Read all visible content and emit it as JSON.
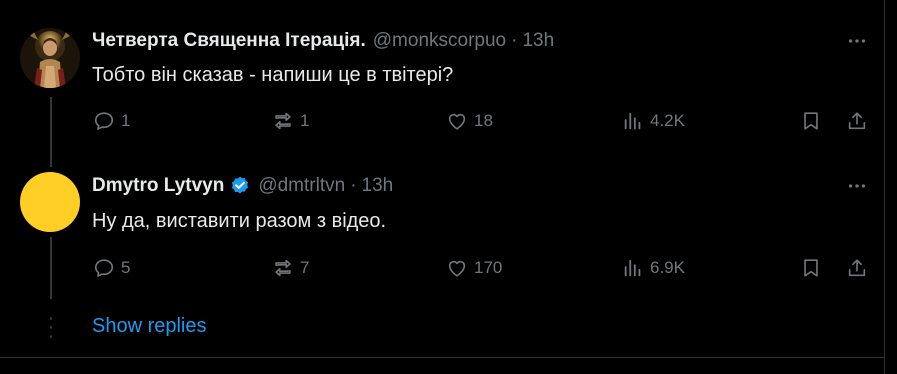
{
  "tweets": [
    {
      "author_name": "Четверта Священна Ітерація.",
      "handle": "@monkscorpuo",
      "separator": "·",
      "time": "13h",
      "text": "Тобто він сказав - напиши це в твітері?",
      "replies": "1",
      "reposts": "1",
      "likes": "18",
      "views": "4.2K",
      "avatar_icon": "monk-portrait-avatar"
    },
    {
      "author_name": "Dmytro Lytvyn",
      "handle": "@dmtrltvn",
      "separator": "·",
      "time": "13h",
      "text": "Ну да, виставити разом з відео.",
      "replies": "5",
      "reposts": "7",
      "likes": "170",
      "views": "6.9K",
      "verified": true,
      "avatar_color": "#ffcf26"
    }
  ],
  "show_replies_label": "Show replies",
  "colors": {
    "background": "#000000",
    "text": "#e7e9ea",
    "muted": "#71767b",
    "accent": "#1d9bf0",
    "divider": "#2f3336"
  },
  "icons": [
    "reply-icon",
    "repost-icon",
    "like-icon",
    "views-icon",
    "bookmark-icon",
    "share-icon",
    "more-icon",
    "verified-badge-icon"
  ]
}
